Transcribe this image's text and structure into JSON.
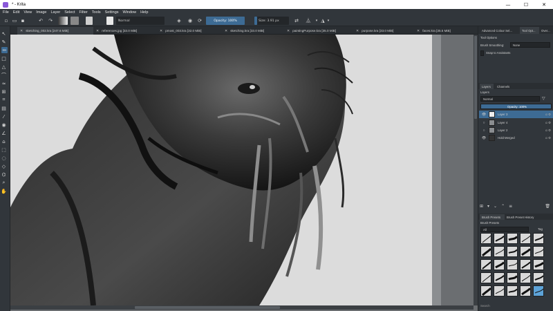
{
  "window": {
    "title": "* - Krita",
    "minimize": "—",
    "maximize": "☐",
    "close": "✕"
  },
  "menu": [
    "File",
    "Edit",
    "View",
    "Image",
    "Layer",
    "Select",
    "Filter",
    "Tools",
    "Settings",
    "Window",
    "Help"
  ],
  "toolbar": {
    "blend_mode": "Normal",
    "opacity": "Opacity: 100%",
    "size": "Size: 3.91 px"
  },
  "doc_tabs": [
    {
      "label": "sketching_002.kra [247.6 MiB]",
      "modified": true
    },
    {
      "label": "references.jpg [33.0 MiB]",
      "modified": false
    },
    {
      "label": "pmost_003.kra [32.0 MiB]",
      "modified": false
    },
    {
      "label": "sketching.kra [33.0 MiB]",
      "modified": false
    },
    {
      "label": "paintingPurpose.kra [35.0 MiB]",
      "modified": false
    },
    {
      "label": "purpose.kra [33.0 MiB]",
      "modified": false
    },
    {
      "label": "faces.kra [35.5 MiB]",
      "modified": false
    }
  ],
  "docker": {
    "top_tabs": [
      "Advanced Colour Sel...",
      "Tool Opt...",
      "Over..."
    ],
    "tool_options_title": "Tool Options",
    "brush_smoothing_label": "Brush Smoothing:",
    "brush_smoothing_value": "None",
    "snap_label": "Snap to Assistants",
    "layer_tabs": [
      "Layers",
      "Channels"
    ],
    "layers_title": "Layers",
    "layer_blend": "Normal",
    "layer_opacity": "Opacity: 100%",
    "layers": [
      {
        "name": "Layer 3",
        "visible": true,
        "selected": true
      },
      {
        "name": "Layer 4",
        "visible": false,
        "selected": false
      },
      {
        "name": "Layer 2",
        "visible": false,
        "selected": false
      },
      {
        "name": "Hold Merged",
        "visible": true,
        "selected": false
      }
    ],
    "preset_tabs": [
      "Brush Presets",
      "Brush Preset History"
    ],
    "presets_title": "Brush Presets",
    "presets_filter": "All",
    "presets_tag": "Tag",
    "search_label": "Search"
  },
  "colors": {
    "accent": "#3d6b94",
    "panel": "#31363b",
    "canvas_bg": "#dedede"
  }
}
